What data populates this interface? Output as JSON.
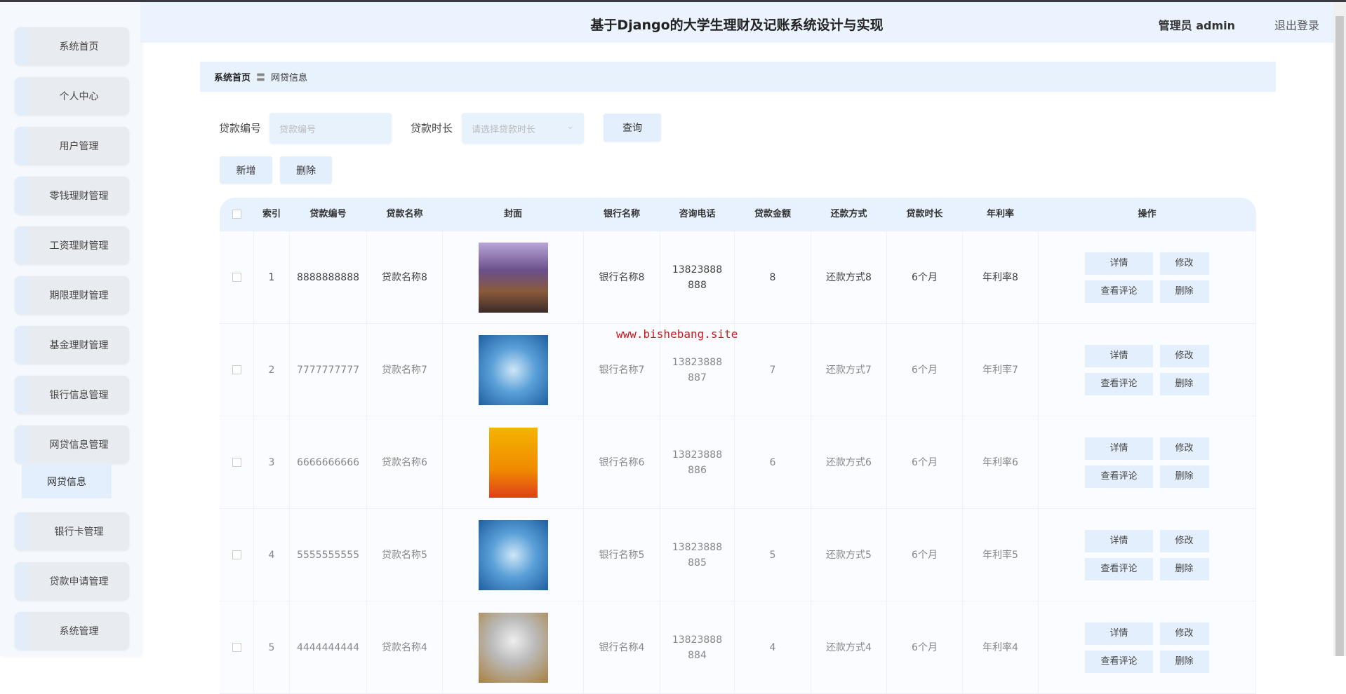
{
  "header": {
    "title": "基于Django的大学生理财及记账系统设计与实现",
    "user": "管理员 admin",
    "logout": "退出登录"
  },
  "sidebar": {
    "items": [
      "系统首页",
      "个人中心",
      "用户管理",
      "零钱理财管理",
      "工资理财管理",
      "期限理财管理",
      "基金理财管理",
      "银行信息管理",
      "网贷信息管理",
      "银行卡管理",
      "贷款申请管理",
      "系统管理"
    ],
    "sub_item": "网贷信息"
  },
  "breadcrumb": {
    "home": "系统首页",
    "sep": "〓",
    "current": "网贷信息"
  },
  "search": {
    "loan_no_label": "贷款编号",
    "loan_no_placeholder": "贷款编号",
    "duration_label": "贷款时长",
    "duration_placeholder": "请选择贷款时长",
    "query": "查询"
  },
  "actions": {
    "add": "新增",
    "delete": "删除"
  },
  "table": {
    "headers": [
      "索引",
      "贷款编号",
      "贷款名称",
      "封面",
      "银行名称",
      "咨询电话",
      "贷款金额",
      "还款方式",
      "贷款时长",
      "年利率",
      "操作"
    ],
    "rows": [
      {
        "index": "1",
        "no": "8888888888",
        "name": "贷款名称8",
        "bank": "银行名称8",
        "phone": "13823888888",
        "amount": "8",
        "repay": "还款方式8",
        "duration": "6个月",
        "rate": "年利率8",
        "cover": "coins"
      },
      {
        "index": "2",
        "no": "7777777777",
        "name": "贷款名称7",
        "bank": "银行名称7",
        "phone": "13823888887",
        "amount": "7",
        "repay": "还款方式7",
        "duration": "6个月",
        "rate": "年利率7",
        "cover": "bond"
      },
      {
        "index": "3",
        "no": "6666666666",
        "name": "贷款名称6",
        "bank": "银行名称6",
        "phone": "13823888886",
        "amount": "6",
        "repay": "还款方式6",
        "duration": "6个月",
        "rate": "年利率6",
        "cover": "fund"
      },
      {
        "index": "4",
        "no": "5555555555",
        "name": "贷款名称5",
        "bank": "银行名称5",
        "phone": "13823888885",
        "amount": "5",
        "repay": "还款方式5",
        "duration": "6个月",
        "rate": "年利率5",
        "cover": "bond"
      },
      {
        "index": "5",
        "no": "4444444444",
        "name": "贷款名称4",
        "bank": "银行名称4",
        "phone": "13823888884",
        "amount": "4",
        "repay": "还款方式4",
        "duration": "6个月",
        "rate": "年利率4",
        "cover": "piggy"
      }
    ],
    "ops": {
      "detail": "详情",
      "edit": "修改",
      "comments": "查看评论",
      "delete": "删除"
    }
  },
  "watermark": "www.bishebang.site"
}
